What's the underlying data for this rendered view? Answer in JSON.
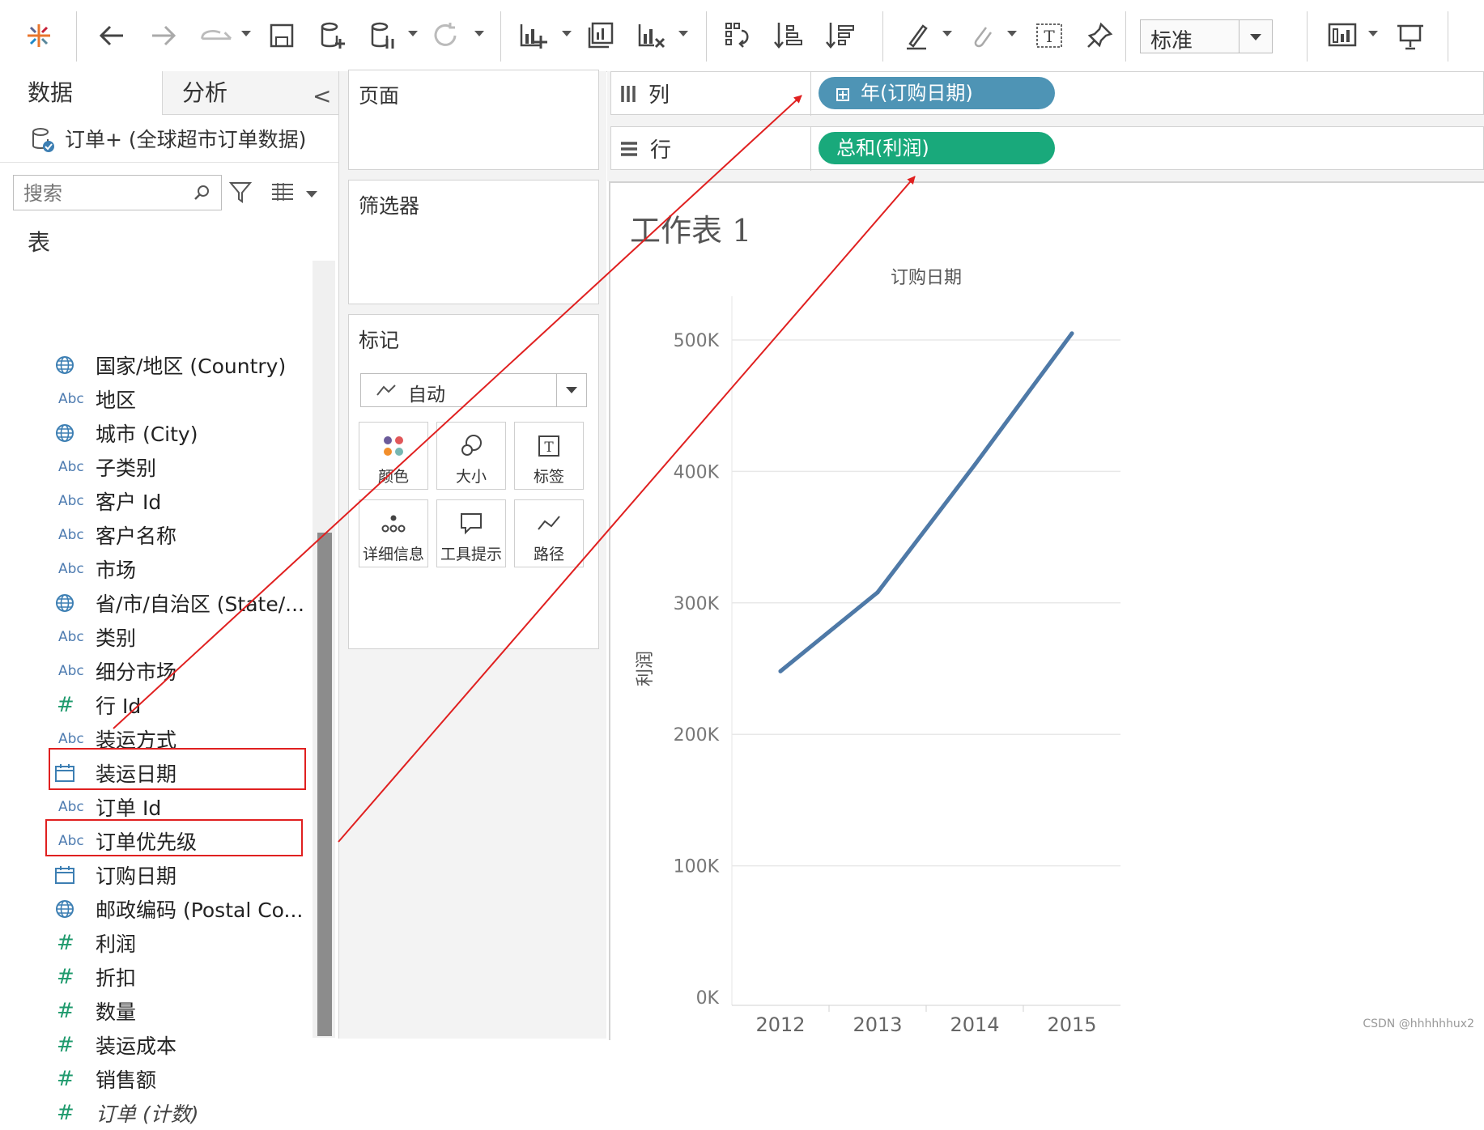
{
  "toolbar": {
    "fit_value": "标准",
    "icons": [
      "tableau-logo-icon",
      "undo-icon",
      "redo-icon",
      "replay-icon",
      "save-icon",
      "new-datasource-icon",
      "pause-update-icon",
      "refresh-icon",
      "new-worksheet-icon",
      "duplicate-sheet-icon",
      "clear-sheet-icon",
      "swap-icon",
      "sort-ascending-icon",
      "sort-descending-icon",
      "highlight-icon",
      "group-icon",
      "label-icon",
      "pin-icon",
      "show-cards-icon",
      "presentation-icon"
    ]
  },
  "data_pane": {
    "tab_data": "数据",
    "tab_analysis": "分析",
    "collapse_glyph": "<",
    "datasource": "订单+ (全球超市订单数据)",
    "search_placeholder": "搜索",
    "tables_heading": "表",
    "fields": [
      {
        "type": "geo",
        "label": "国家/地区 (Country)"
      },
      {
        "type": "abc",
        "label": "地区"
      },
      {
        "type": "geo",
        "label": "城市 (City)"
      },
      {
        "type": "abc",
        "label": "子类别"
      },
      {
        "type": "abc",
        "label": "客户 Id"
      },
      {
        "type": "abc",
        "label": "客户名称"
      },
      {
        "type": "abc",
        "label": "市场"
      },
      {
        "type": "geo",
        "label": "省/市/自治区 (State/..."
      },
      {
        "type": "abc",
        "label": "类别"
      },
      {
        "type": "abc",
        "label": "细分市场"
      },
      {
        "type": "num",
        "label": "行 Id"
      },
      {
        "type": "abc",
        "label": "装运方式"
      },
      {
        "type": "date",
        "label": "装运日期"
      },
      {
        "type": "abc",
        "label": "订单 Id"
      },
      {
        "type": "abc",
        "label": "订单优先级"
      },
      {
        "type": "date",
        "label": "订购日期",
        "highlighted": true
      },
      {
        "type": "geo",
        "label": "邮政编码 (Postal Co..."
      },
      {
        "type": "num",
        "label": "利润",
        "highlighted": true
      },
      {
        "type": "num",
        "label": "折扣"
      },
      {
        "type": "num",
        "label": "数量"
      },
      {
        "type": "num",
        "label": "装运成本"
      },
      {
        "type": "num",
        "label": "销售额"
      },
      {
        "type": "num",
        "label": "订单 (计数)",
        "italic": true
      }
    ],
    "abc_text": "Abc",
    "num_text": "#"
  },
  "cards": {
    "pages_title": "页面",
    "filters_title": "筛选器",
    "marks_title": "标记",
    "mark_type": "自动",
    "mark_buttons": [
      {
        "label": "颜色",
        "icon": "color-icon"
      },
      {
        "label": "大小",
        "icon": "size-icon"
      },
      {
        "label": "标签",
        "icon": "label-icon"
      },
      {
        "label": "详细信息",
        "icon": "detail-icon"
      },
      {
        "label": "工具提示",
        "icon": "tooltip-icon"
      },
      {
        "label": "路径",
        "icon": "path-icon"
      }
    ]
  },
  "shelves": {
    "columns_label": "列",
    "rows_label": "行",
    "columns_pill": "年(订购日期)",
    "rows_pill": "总和(利润)",
    "columns_pill_color": "#4e94b5",
    "rows_pill_color": "#19a97b"
  },
  "view": {
    "sheet_title": "工作表 1",
    "watermark": "CSDN @hhhhhhux2"
  },
  "chart_data": {
    "type": "line",
    "title": "",
    "xlabel": "订购日期",
    "ylabel": "利润",
    "categories": [
      "2012",
      "2013",
      "2014",
      "2015"
    ],
    "series": [
      {
        "values": [
          248000,
          308000,
          405000,
          505000
        ],
        "color": "#4e79a7"
      }
    ],
    "ylim": [
      0,
      500000
    ],
    "yticks": [
      0,
      100000,
      200000,
      300000,
      400000,
      500000
    ],
    "ytick_labels": [
      "0K",
      "100K",
      "200K",
      "300K",
      "400K",
      "500K"
    ],
    "grid": true
  }
}
